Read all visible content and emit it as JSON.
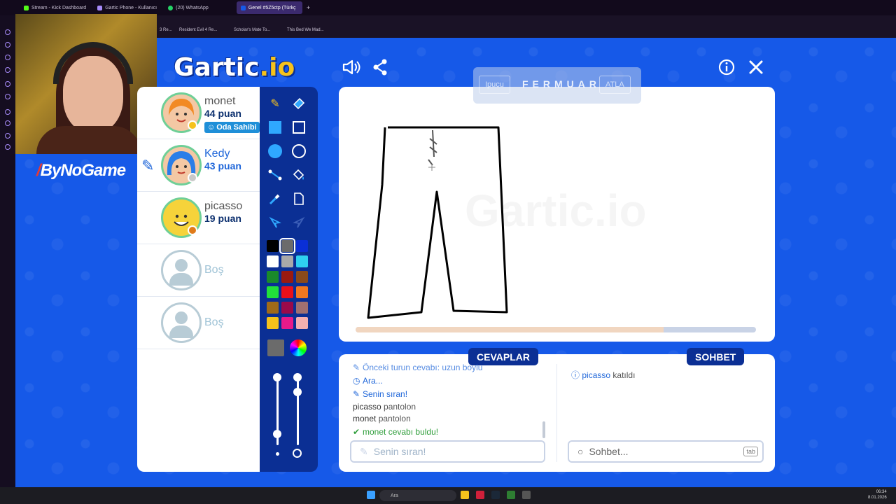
{
  "browser": {
    "tabs": [
      {
        "label": "Stream - Kick Dashboard",
        "active": false
      },
      {
        "label": "Gartic Phone - Kullanıcı",
        "active": false
      },
      {
        "label": "(20) WhatsApp",
        "active": false
      },
      {
        "label": "Genel #5Z5ctp (Türkç",
        "active": true
      }
    ],
    "bookmarks": [
      "3 Re...",
      "Resident Evil 4 Re...",
      "Scholar's Mate To...",
      "This Bed We Mad..."
    ]
  },
  "overlay": {
    "brand": "ByNoGame"
  },
  "game": {
    "logo": "Gartic",
    "logo_suffix": ".io",
    "hint": {
      "left": "Ipucu",
      "word": "FERMUAR",
      "right": "ATLA"
    },
    "watermark": "Gartic.io",
    "round_progress": 0.77
  },
  "players": [
    {
      "name": "monet",
      "score": "44 puan",
      "owner_badge": "Oda Sahibi",
      "status_color": "#f6c21c",
      "drawing": false
    },
    {
      "name": "Kedy",
      "score": "43 puan",
      "status_color": "#c8c8c8",
      "drawing": true
    },
    {
      "name": "picasso",
      "score": "19 puan",
      "status_color": "#e07b1a",
      "drawing": false
    },
    {
      "name": "Boş"
    },
    {
      "name": "Boş"
    }
  ],
  "toolbar": {
    "palette": [
      "#000000",
      "#6b6b6b",
      "#0a2fd6",
      "#ffffff",
      "#a9a9a9",
      "#2fd0f0",
      "#1a8a2a",
      "#9a1a10",
      "#8a4a1a",
      "#21e03a",
      "#e8101a",
      "#f07820",
      "#a06a18",
      "#9a0a4a",
      "#a07070",
      "#f6c21c",
      "#e81a8a",
      "#f4b0b0"
    ],
    "selected_color": "#6b6b6b"
  },
  "answers": {
    "label": "CEVAPLAR",
    "messages": [
      {
        "icon": "pencil-icon",
        "prefix": "Önceki turun cevabı: ",
        "text": "uzun boylu",
        "style": "blue"
      },
      {
        "icon": "clock-icon",
        "text": "Ara...",
        "style": "blue"
      },
      {
        "icon": "pencil-icon",
        "text": "Senin sıran!",
        "style": "blue"
      },
      {
        "user": "picasso",
        "text": "pantolon",
        "style": "plain"
      },
      {
        "user": "monet",
        "text": "pantolon",
        "style": "plain"
      },
      {
        "icon": "check-icon",
        "user": "monet",
        "text": "cevabı buldu!",
        "style": "green"
      }
    ],
    "input_placeholder": "Senin sıran!"
  },
  "chat": {
    "label": "SOHBET",
    "messages": [
      {
        "icon": "info-icon",
        "user": "picasso",
        "text": "katıldı"
      }
    ],
    "input_placeholder": "Sohbet...",
    "shortcut": "tab"
  },
  "taskbar": {
    "search_placeholder": "Ara",
    "time": "06:34",
    "date": "8.01.2026"
  }
}
